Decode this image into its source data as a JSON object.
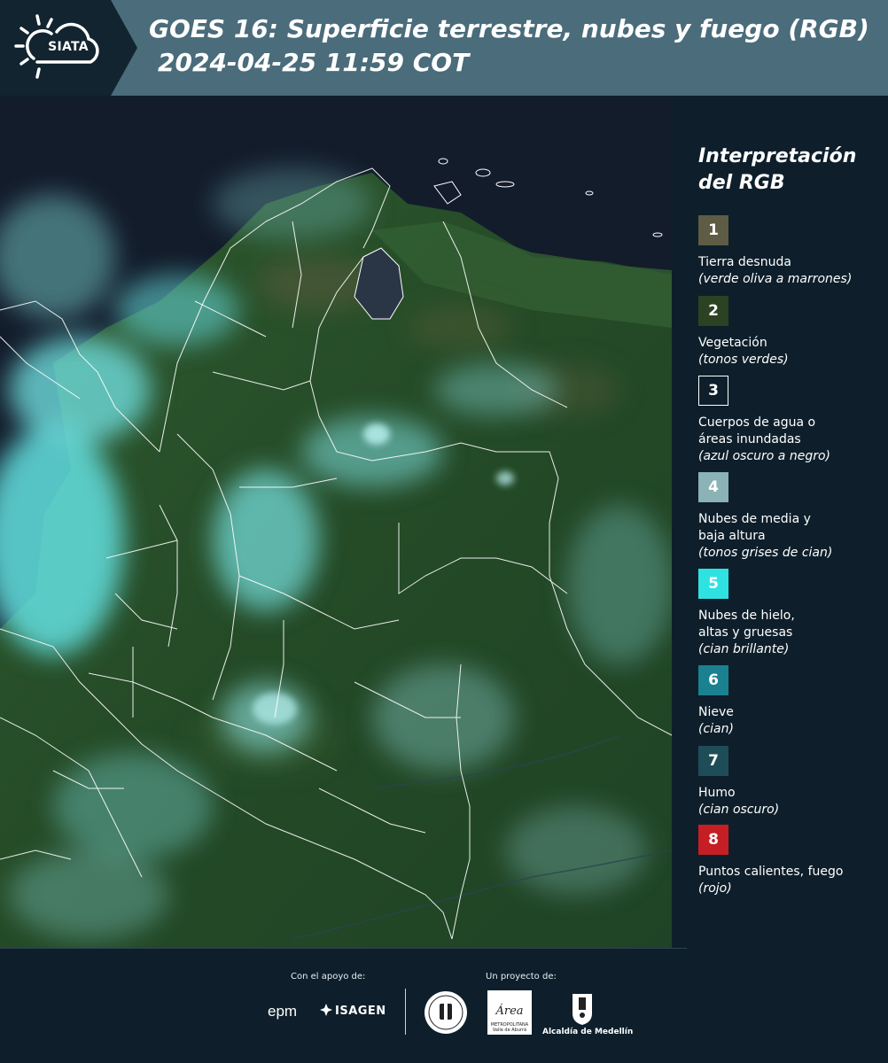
{
  "header": {
    "logo_text": "SIATA",
    "title": "GOES 16: Superficie terrestre, nubes y fuego (RGB)",
    "subtitle": "2024-04-25 11:59 COT"
  },
  "map": {
    "background_color": "#1f4a2a",
    "cloud_color": "#5fd9d9",
    "water_color": "#10192a",
    "border_color": "#ffffff"
  },
  "legend": {
    "title_line1": "Interpretación",
    "title_line2": "del RGB",
    "items": [
      {
        "number": "1",
        "label": "Tierra desnuda",
        "desc": "(verde oliva a marrones)",
        "color": "#5e5c44"
      },
      {
        "number": "2",
        "label": "Vegetación",
        "desc": "(tonos verdes)",
        "color": "#2c4222"
      },
      {
        "number": "3",
        "label": "Cuerpos de agua o áreas inundadas",
        "desc": "(azul oscuro a negro)",
        "color": "#0e1f2b"
      },
      {
        "number": "4",
        "label": "Nubes de media y baja altura",
        "desc": "(tonos grises de cian)",
        "color": "#8bb2b4"
      },
      {
        "number": "5",
        "label": "Nubes de hielo, altas y gruesas",
        "desc": "(cian brillante)",
        "color": "#2fe2e2"
      },
      {
        "number": "6",
        "label": "Nieve",
        "desc": "(cian)",
        "color": "#1a8191"
      },
      {
        "number": "7",
        "label": "Humo",
        "desc": "(cian oscuro)",
        "color": "#1e4d57"
      },
      {
        "number": "8",
        "label": "Puntos calientes, fuego",
        "desc": "(rojo)",
        "color": "#c61e25"
      }
    ]
  },
  "footer": {
    "support_label": "Con el apoyo de:",
    "project_label": "Un proyecto de:",
    "epm": "epm",
    "isagen": "ISAGEN",
    "area_logo": "Área",
    "area_sub": "METROPOLITANA Valle de Aburrá",
    "alcaldia": "Alcaldía de Medellín"
  }
}
